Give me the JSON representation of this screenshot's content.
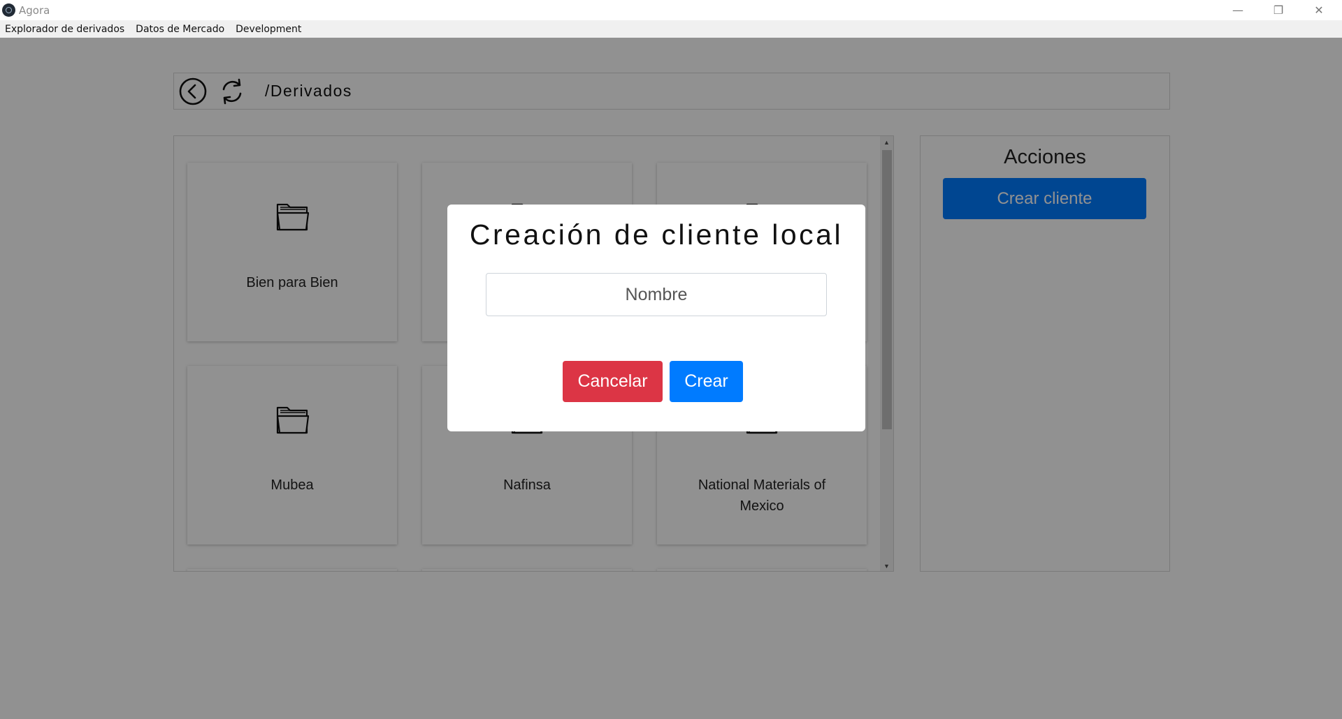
{
  "window": {
    "title": "Agora",
    "controls": {
      "minimize": "—",
      "maximize": "❐",
      "close": "✕"
    }
  },
  "menu": {
    "items": [
      {
        "label": "Explorador de derivados"
      },
      {
        "label": "Datos de Mercado"
      },
      {
        "label": "Development"
      }
    ]
  },
  "pathbar": {
    "path": "/Derivados",
    "back_icon": "back-arrow-circle-icon",
    "refresh_icon": "refresh-icon"
  },
  "folders": {
    "items": [
      {
        "label": "Bien para Bien"
      },
      {
        "label": ""
      },
      {
        "label": ""
      },
      {
        "label": "Mubea"
      },
      {
        "label": "Nafinsa"
      },
      {
        "label": "National Materials of Mexico"
      },
      {
        "label": ""
      },
      {
        "label": ""
      },
      {
        "label": ""
      }
    ],
    "icon": "folder-open-icon"
  },
  "actions": {
    "title": "Acciones",
    "create_client_label": "Crear cliente"
  },
  "modal": {
    "title": "Creación de cliente local",
    "name_placeholder": "Nombre",
    "name_value": "",
    "cancel_label": "Cancelar",
    "create_label": "Crear"
  },
  "colors": {
    "primary": "#007bff",
    "danger": "#dc3545",
    "overlay": "rgba(0,0,0,0.43)"
  }
}
